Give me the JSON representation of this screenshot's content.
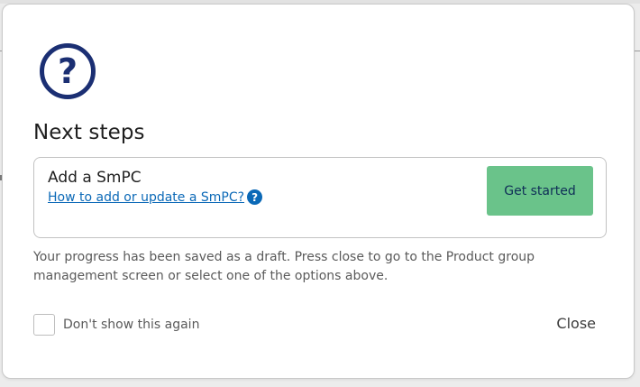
{
  "modal": {
    "title": "Next steps",
    "icon": "help-circle-icon",
    "icon_symbol": "?",
    "icon_color": "#1b2f73",
    "step": {
      "title": "Add a SmPC",
      "help_link": "How to add or update a SmPC?",
      "help_icon": "info-question-icon",
      "help_icon_symbol": "?",
      "action_label": "Get started"
    },
    "description": "Your progress has been saved as a draft. Press close to go to the Product group management screen or select one of the options above.",
    "dont_show_label": "Don't show this again",
    "dont_show_checked": false,
    "close_label": "Close"
  },
  "colors": {
    "accent_button": "#6ac38a",
    "link": "#0b69b7",
    "icon": "#1b2f73"
  }
}
